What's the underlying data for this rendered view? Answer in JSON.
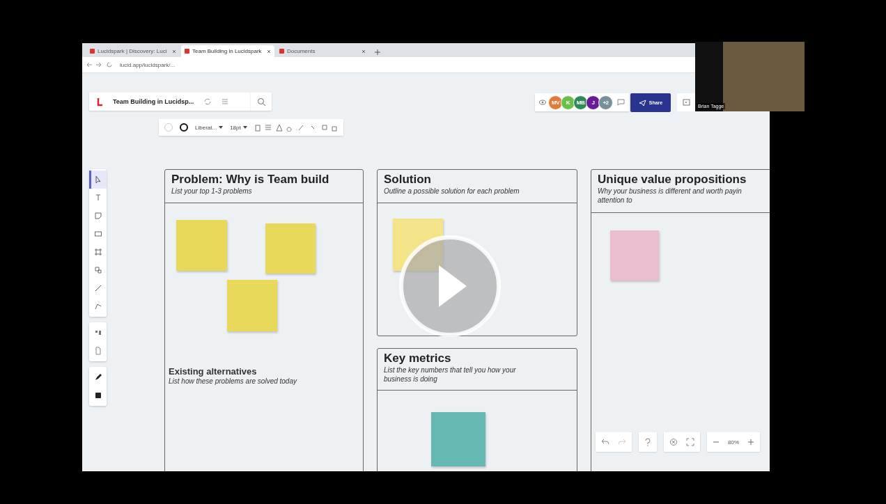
{
  "browser": {
    "tabs": [
      {
        "title": "Lucidspark | Discovery: Luci",
        "selected": false
      },
      {
        "title": "Team Building in Lucidspark",
        "selected": true
      },
      {
        "title": "Documents",
        "selected": false
      }
    ],
    "url": "lucid.app/lucidspark/..."
  },
  "document": {
    "title": "Team Building in Lucidsp..."
  },
  "format_toolbar": {
    "font": "Liberat...",
    "size": "18pt"
  },
  "collaborators": [
    {
      "initials": "MV",
      "color": "#e07b39"
    },
    {
      "initials": "K",
      "color": "#6cc04a"
    },
    {
      "initials": "MB",
      "color": "#2e8b57"
    },
    {
      "initials": "J",
      "color": "#6a1b9a"
    },
    {
      "initials": "+2",
      "color": "#78909c"
    }
  ],
  "share_button": "Share",
  "tools": [
    {
      "kind": "pointer",
      "selected": true
    },
    {
      "kind": "text",
      "selected": false
    },
    {
      "kind": "sticky",
      "selected": false
    },
    {
      "kind": "rect",
      "selected": false
    },
    {
      "kind": "frame",
      "selected": false
    },
    {
      "kind": "shapes",
      "selected": false
    },
    {
      "kind": "line",
      "selected": false
    },
    {
      "kind": "pen",
      "selected": false
    },
    {
      "kind": "template",
      "selected": false
    },
    {
      "kind": "doc",
      "selected": false
    },
    {
      "kind": "marker",
      "selected": false
    },
    {
      "kind": "stamp",
      "selected": false
    }
  ],
  "board": {
    "sections": [
      {
        "title": "Problem: Why is Team build",
        "subtitle_lines": [
          "List your top 1-3 problems"
        ],
        "sticky_notes": [
          {
            "color": "#e8d95b"
          },
          {
            "color": "#e8d95b"
          },
          {
            "color": "#e8d95b"
          }
        ]
      },
      {
        "title": "Solution",
        "subtitle_lines": [
          "Outline a possible solution for each problem"
        ],
        "sticky_notes": [
          {
            "color": "#f3e48a"
          }
        ]
      },
      {
        "title": "Key metrics",
        "subtitle_lines": [
          "List the key numbers that tell you how your",
          "business is doing"
        ],
        "sticky_notes": [
          {
            "color": "#66b8b2"
          }
        ]
      },
      {
        "title": "Unique value propositions",
        "subtitle_lines": [
          "Why your business is different and worth payin",
          "attention to"
        ],
        "sticky_notes": [
          {
            "color": "#eabdd0"
          }
        ]
      }
    ],
    "subsection": {
      "title": "Existing alternatives",
      "subtitle": "List how these problems are solved today"
    }
  },
  "zoom_level": "80%",
  "webcam": {
    "name": "Brian Tagge"
  }
}
